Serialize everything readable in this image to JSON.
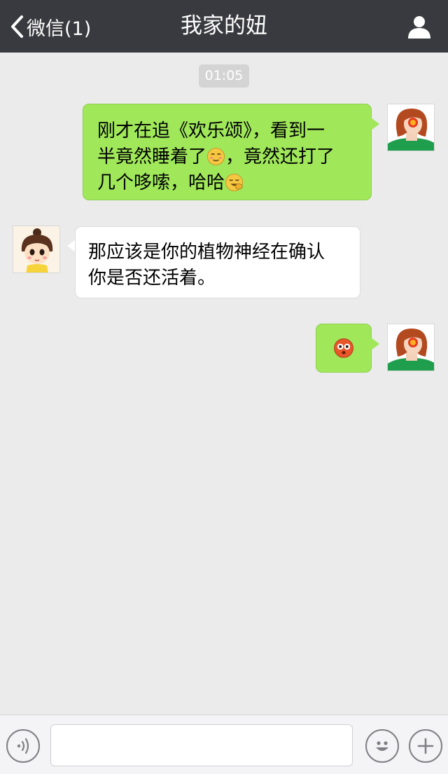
{
  "nav": {
    "back_label": "微信(1)",
    "title": "我家的妞"
  },
  "timestamp": "01:05",
  "messages": [
    {
      "side": "right",
      "lines": [
        "刚才在追《欢乐颂》，看到一",
        "半竟然睡着了",
        "，竟然还打了",
        "几个哆嗦，哈哈"
      ],
      "emojis": [
        "awkward-smile-emoji",
        "laugh-cover-emoji"
      ]
    },
    {
      "side": "left",
      "lines": [
        "那应该是你的植物神经在确认",
        "你是否还活着。"
      ]
    },
    {
      "side": "right",
      "emojis": [
        "wide-eyed-emoji"
      ]
    }
  ],
  "input": {
    "value": "",
    "placeholder": ""
  },
  "icons": {
    "back": "chevron-left-icon",
    "profile": "person-icon",
    "voice": "voice-icon",
    "emoji": "smiley-icon",
    "more": "plus-icon"
  },
  "colors": {
    "nav_bg": "#393a3f",
    "chat_bg": "#ebebeb",
    "sent_bubble": "#a0e75a",
    "received_bubble": "#ffffff"
  }
}
